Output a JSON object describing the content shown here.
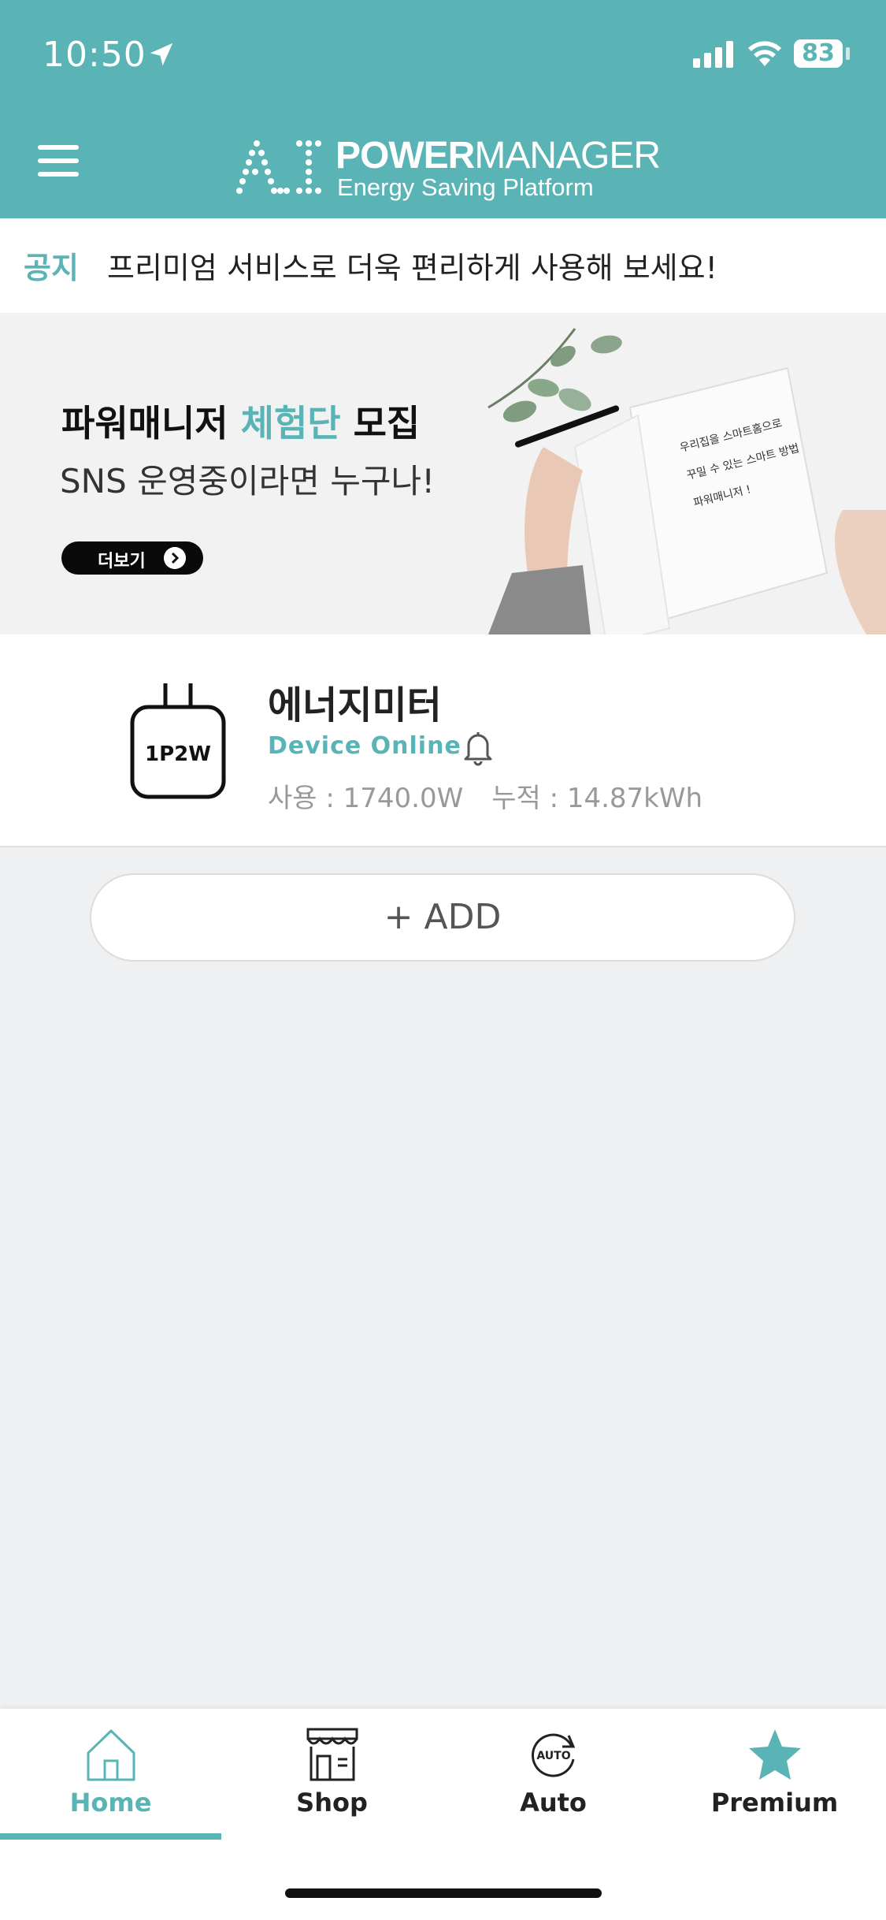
{
  "status_bar": {
    "time": "10:50",
    "battery": "83"
  },
  "header": {
    "logo_ai": "AI",
    "logo_power": "POWER",
    "logo_manager": "MANAGER",
    "logo_sub": "Energy Saving Platform"
  },
  "notice": {
    "label": "공지",
    "text": "프리미엄 서비스로 더욱 편리하게 사용해 보세요!"
  },
  "banner": {
    "title_a": "파워매니저 ",
    "title_hl": "체험단",
    "title_b": " 모집",
    "subtitle": "SNS 운영중이라면 누구나!",
    "more_label": "더보기",
    "notebook_text_1": "우리집을 스마트홈으로",
    "notebook_text_2": "꾸밀 수 있는 스마트 방법",
    "notebook_text_3": "파워매니저 !"
  },
  "device": {
    "type_badge": "1P2W",
    "name": "에너지미터",
    "status": "Device Online",
    "usage": "사용 : 1740.0W",
    "cumulative": "누적 : 14.87kWh"
  },
  "add_button": {
    "label": "+ ADD"
  },
  "tabs": [
    {
      "label": "Home",
      "icon": "home-icon",
      "active": true
    },
    {
      "label": "Shop",
      "icon": "shop-icon",
      "active": false
    },
    {
      "label": "Auto",
      "icon": "auto-icon",
      "active": false
    },
    {
      "label": "Premium",
      "icon": "star-icon",
      "active": false
    }
  ],
  "colors": {
    "accent": "#5ab3b4",
    "background": "#eff0f2"
  }
}
